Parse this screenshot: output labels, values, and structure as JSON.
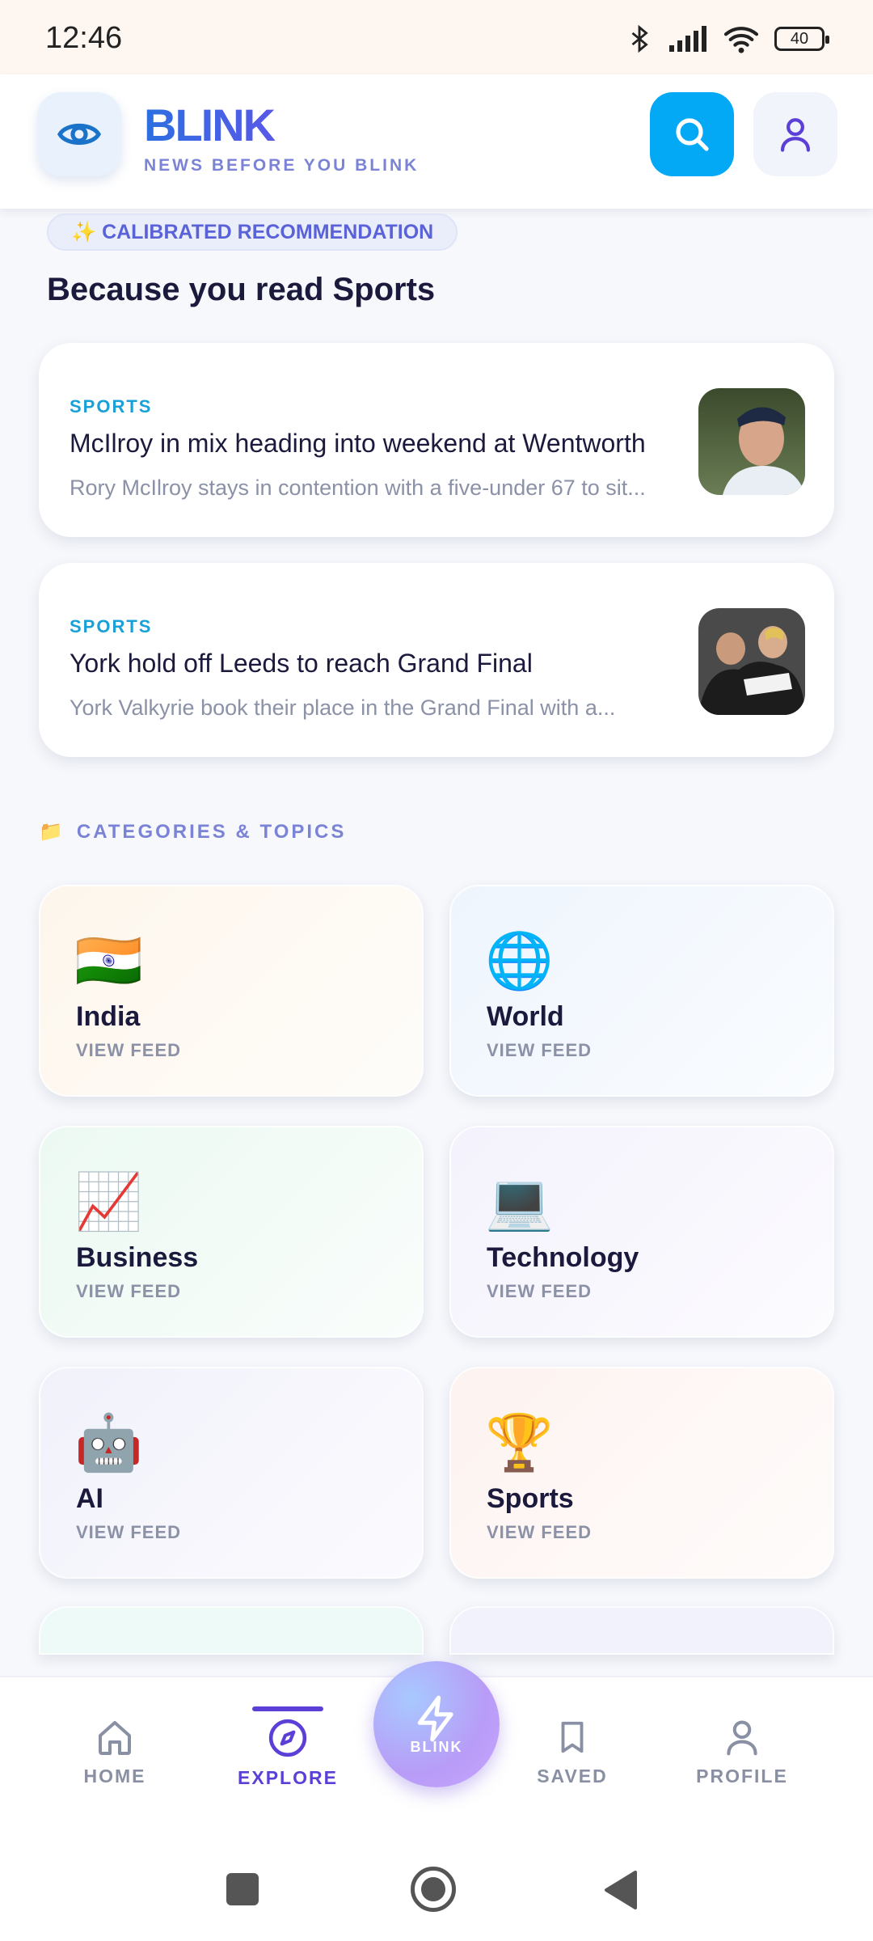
{
  "status_bar": {
    "time": "12:46",
    "battery": "40"
  },
  "header": {
    "app_name": "BLINK",
    "tagline": "NEWS BEFORE YOU BLINK",
    "icons": [
      "eye-icon",
      "search-icon",
      "user-icon"
    ]
  },
  "recommendation": {
    "badge": "✨ CALIBRATED RECOMMENDATION",
    "title": "Because you read Sports",
    "articles": [
      {
        "category": "SPORTS",
        "headline": "McIlroy in mix heading into weekend at Wentworth",
        "summary": "Rory McIlroy stays in contention with a five-under 67 to sit..."
      },
      {
        "category": "SPORTS",
        "headline": "York hold off Leeds to reach Grand Final",
        "summary": "York Valkyrie book their place in the Grand Final with a..."
      }
    ]
  },
  "categories": {
    "header": "CATEGORIES & TOPICS",
    "header_icon": "📁",
    "view_label": "VIEW FEED",
    "items": [
      {
        "name": "India",
        "icon": "🇮🇳",
        "bg": "#fdf6ec"
      },
      {
        "name": "World",
        "icon": "🌐",
        "bg": "#eef5fd"
      },
      {
        "name": "Business",
        "icon": "📈",
        "bg": "#ecf9f2"
      },
      {
        "name": "Technology",
        "icon": "💻",
        "bg": "#f4f2fc"
      },
      {
        "name": "AI",
        "icon": "🤖",
        "bg": "#f1f1fb"
      },
      {
        "name": "Sports",
        "icon": "🏆",
        "bg": "#fdf3f0"
      }
    ]
  },
  "bottom_nav": {
    "home": "HOME",
    "explore": "EXPLORE",
    "center": "BLINK",
    "saved": "SAVED",
    "profile": "PROFILE",
    "active": "explore"
  },
  "colors": {
    "accent": "#5b3fd6",
    "search": "#03a9f4",
    "category_label": "#1aa0d8"
  }
}
